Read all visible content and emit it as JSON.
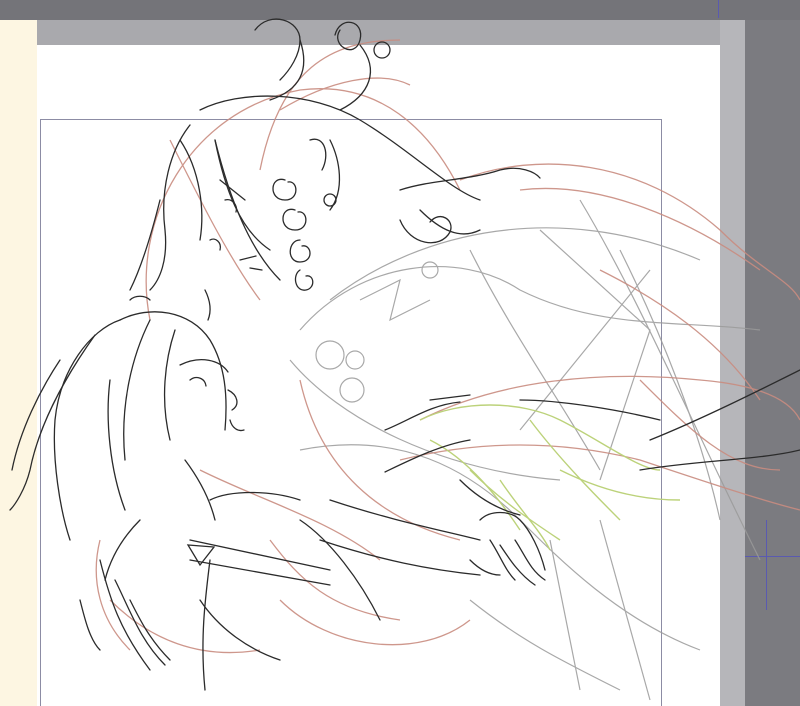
{
  "window": {
    "app_area": "drawing-canvas"
  },
  "colors": {
    "outside": "#7b7b80",
    "paper": "#ffffff",
    "paper_border": "#a9a9ad",
    "side_strip": "#fdf6e2",
    "frame_line": "#8c8ca4",
    "guide": "#5a5ab0",
    "lineart": "#2b2b2b",
    "sketch_red": "#c98c80",
    "sketch_gray": "#9a9a9a",
    "sketch_green": "#bcd27a"
  },
  "artwork": {
    "subject": "two-characters-sketch",
    "layers": [
      "lineart",
      "red-sketch",
      "gray-sketch",
      "green-sketch"
    ]
  }
}
